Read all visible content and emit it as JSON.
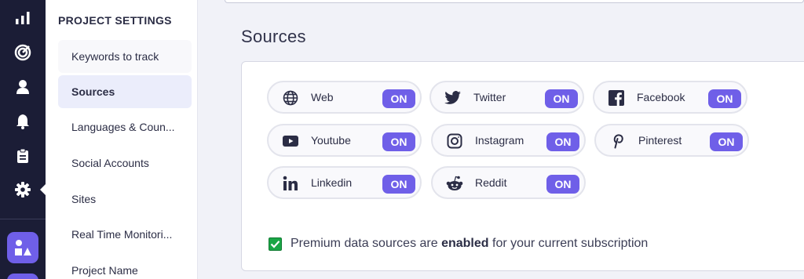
{
  "rail": {
    "icons": [
      "bar-chart-icon",
      "radar-icon",
      "user-icon",
      "bell-icon",
      "clipboard-icon",
      "gear-icon"
    ],
    "active": "gear-icon"
  },
  "settings": {
    "title": "PROJECT SETTINGS",
    "items": [
      {
        "label": "Keywords to track"
      },
      {
        "label": "Sources"
      },
      {
        "label": "Languages & Coun..."
      },
      {
        "label": "Social Accounts"
      },
      {
        "label": "Sites"
      },
      {
        "label": "Real Time Monitori..."
      },
      {
        "label": "Project Name"
      }
    ],
    "active_item": "Sources"
  },
  "main": {
    "title": "Sources",
    "sources": [
      {
        "name": "Web",
        "icon": "globe-icon",
        "state": "ON"
      },
      {
        "name": "Twitter",
        "icon": "twitter-icon",
        "state": "ON"
      },
      {
        "name": "Facebook",
        "icon": "facebook-icon",
        "state": "ON"
      },
      {
        "name": "Youtube",
        "icon": "youtube-icon",
        "state": "ON"
      },
      {
        "name": "Instagram",
        "icon": "instagram-icon",
        "state": "ON"
      },
      {
        "name": "Pinterest",
        "icon": "pinterest-icon",
        "state": "ON"
      },
      {
        "name": "Linkedin",
        "icon": "linkedin-icon",
        "state": "ON"
      },
      {
        "name": "Reddit",
        "icon": "reddit-icon",
        "state": "ON"
      }
    ],
    "premium": {
      "before": "Premium data sources are ",
      "bold": "enabled",
      "after": " for your current subscription",
      "checked": true
    }
  },
  "colors": {
    "accent": "#6f5fe8",
    "rail_bg": "#1b1d36",
    "checkbox_green": "#1aa646"
  }
}
